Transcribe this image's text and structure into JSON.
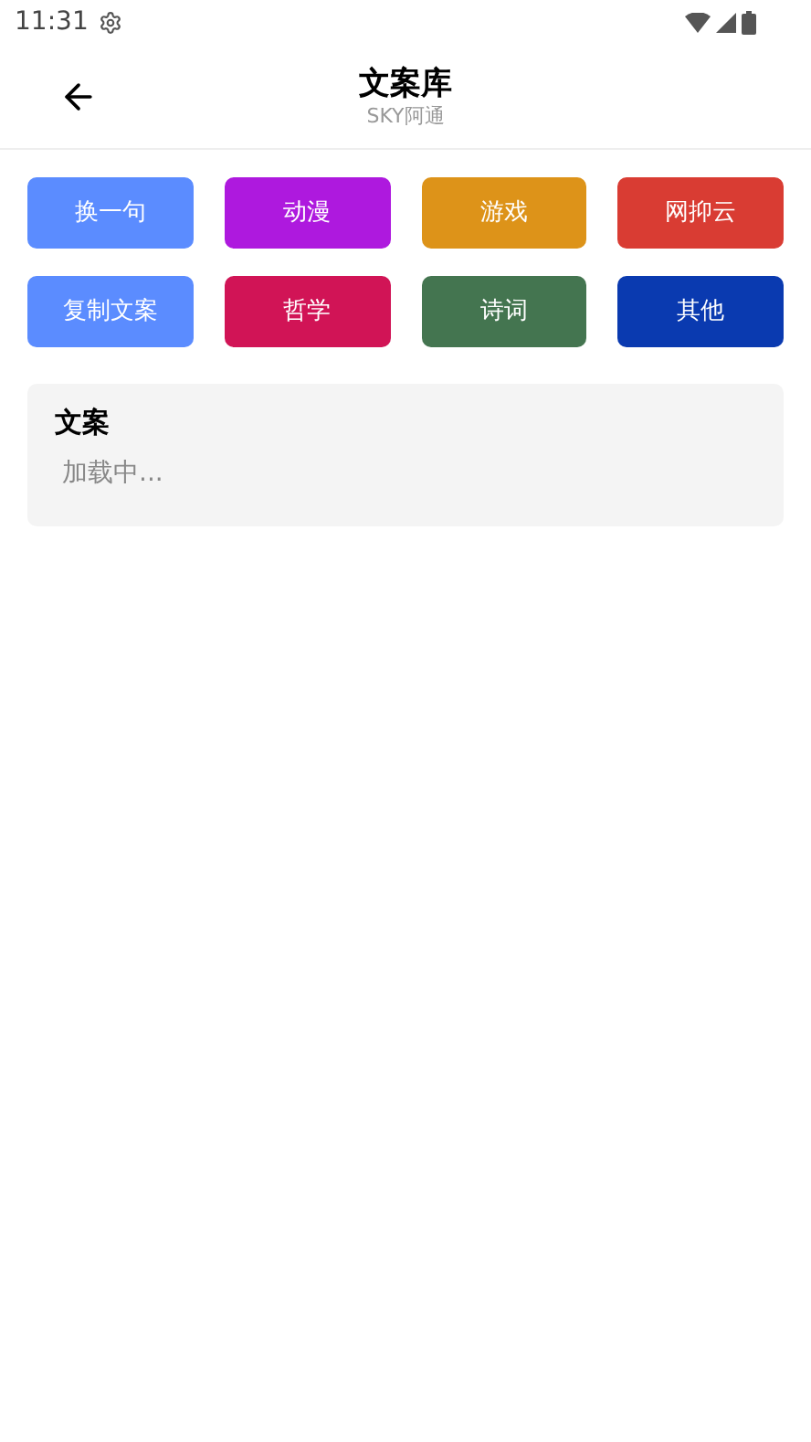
{
  "status_bar": {
    "time": "11:31"
  },
  "header": {
    "title": "文案库",
    "subtitle": "SKY阿通"
  },
  "buttons": [
    {
      "label": "换一句",
      "color": "#5b8cff"
    },
    {
      "label": "动漫",
      "color": "#ae19de"
    },
    {
      "label": "游戏",
      "color": "#dd9319"
    },
    {
      "label": "网抑云",
      "color": "#d93c33"
    },
    {
      "label": "复制文案",
      "color": "#5b8cff"
    },
    {
      "label": "哲学",
      "color": "#d11456"
    },
    {
      "label": "诗词",
      "color": "#447550"
    },
    {
      "label": "其他",
      "color": "#0a3ab0"
    }
  ],
  "card": {
    "title": "文案",
    "text": "加载中..."
  }
}
